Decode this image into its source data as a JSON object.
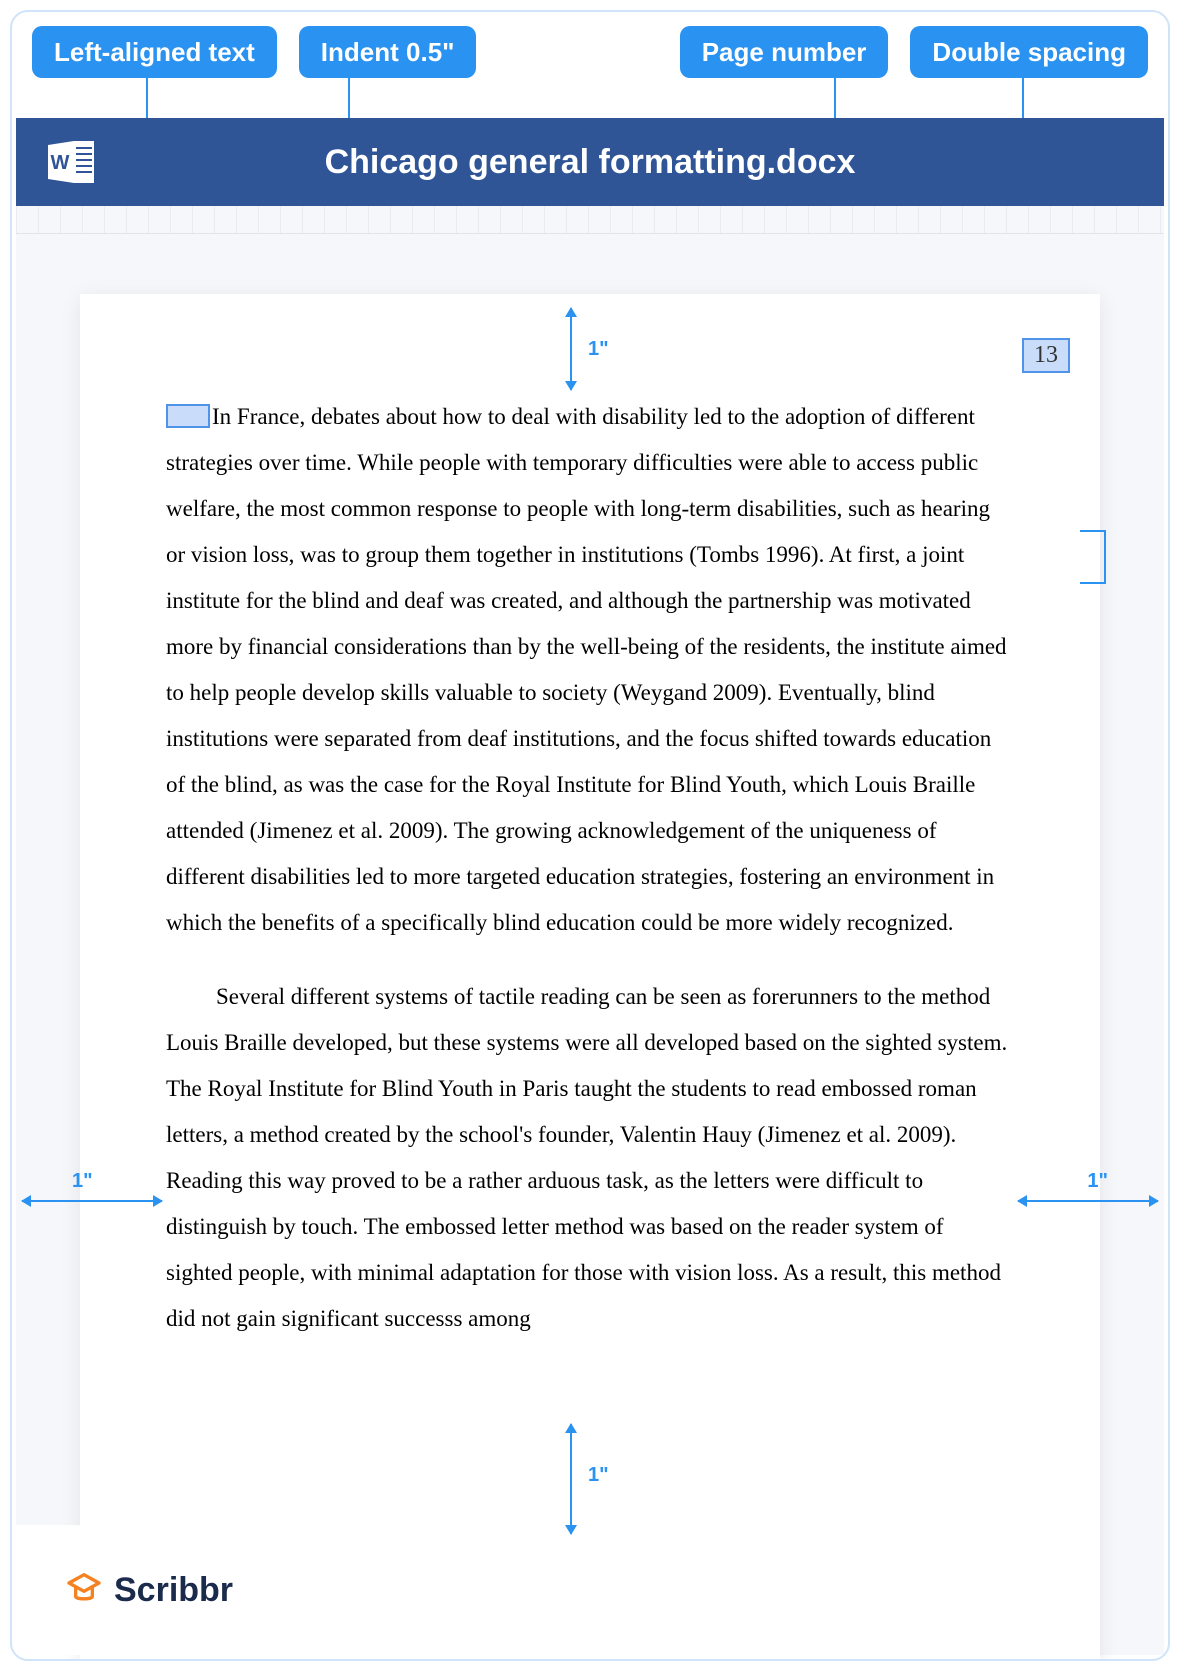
{
  "labels": {
    "left_aligned": "Left-aligned text",
    "indent": "Indent 0.5\"",
    "page_number": "Page number",
    "double_spacing": "Double spacing"
  },
  "header": {
    "title": "Chicago general formatting.docx",
    "icon": "word-icon"
  },
  "page": {
    "number": "13",
    "paragraph1": "In France, debates about how to deal with disability led to the adoption of different strategies over time. While people with temporary difficulties were able to access public welfare, the most common response to people with long-term disabilities, such as hearing or vision loss, was to group them together in institutions (Tombs 1996). At first, a joint institute for the blind and deaf was created, and although the partnership was motivated more by financial considerations than by the well-being of the residents, the institute aimed to help people develop skills valuable to society (Weygand 2009). Eventually, blind institutions were separated from deaf institutions, and the focus shifted towards education of the blind, as was the case for the Royal Institute for Blind Youth, which Louis Braille attended (Jimenez et al. 2009). The growing acknowledgement of the uniqueness of different disabilities led to more targeted education strategies, fostering an environment in which the benefits of a specifically blind education could be more widely recognized.",
    "paragraph2": "Several different systems of tactile reading can be seen as forerunners to the method Louis Braille developed, but these systems were all developed based on the sighted system. The Royal Institute for Blind Youth in Paris taught the students to read embossed roman letters, a method created by the school's founder, Valentin Hauy (Jimenez et al. 2009). Reading this way proved to be a rather arduous task, as the letters were difficult to distinguish by touch. The embossed letter method was based on the reader system of sighted people, with minimal adaptation for those with vision loss. As a result, this method did not gain significant successs among"
  },
  "margins": {
    "top": "1\"",
    "left": "1\"",
    "right": "1\"",
    "bottom": "1\""
  },
  "brand": {
    "name": "Scribbr"
  }
}
